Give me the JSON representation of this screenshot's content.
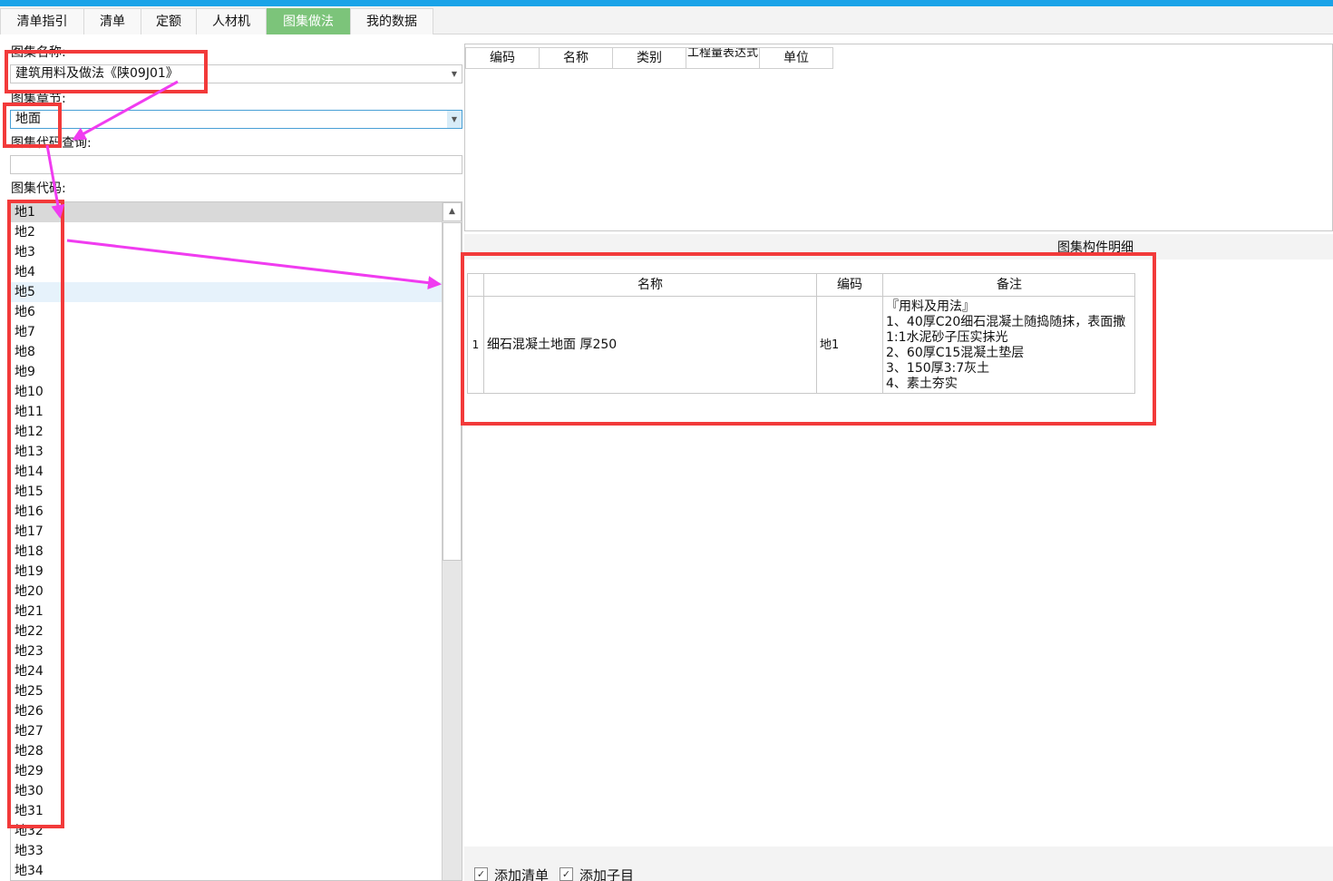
{
  "tabs": [
    {
      "label": "清单指引",
      "active": false
    },
    {
      "label": "清单",
      "active": false
    },
    {
      "label": "定额",
      "active": false
    },
    {
      "label": "人材机",
      "active": false
    },
    {
      "label": "图集做法",
      "active": true
    },
    {
      "label": "我的数据",
      "active": false
    }
  ],
  "atlas_name": {
    "label": "图集名称:",
    "value": "建筑用料及做法《陕09J01》"
  },
  "atlas_chapter": {
    "label": "图集章节:",
    "value": "地面"
  },
  "code_query": {
    "label": "图集代码查询:",
    "value": ""
  },
  "code_list": {
    "label": "图集代码:",
    "selected": "地1",
    "items": [
      "地1",
      "地2",
      "地3",
      "地4",
      "地5",
      "地6",
      "地7",
      "地8",
      "地9",
      "地10",
      "地11",
      "地12",
      "地13",
      "地14",
      "地15",
      "地16",
      "地17",
      "地18",
      "地19",
      "地20",
      "地21",
      "地22",
      "地23",
      "地24",
      "地25",
      "地26",
      "地27",
      "地28",
      "地29",
      "地30",
      "地31",
      "地32",
      "地33",
      "地34"
    ]
  },
  "upper_grid": {
    "columns": [
      "编码",
      "名称",
      "类别",
      "工程量表达式",
      "单位"
    ]
  },
  "detail": {
    "title": "图集构件明细",
    "columns": [
      "名称",
      "编码",
      "备注"
    ],
    "rows": [
      {
        "index": "1",
        "name": "细石混凝土地面 厚250",
        "code": "地1",
        "remark": [
          "『用料及用法』",
          "1、40厚C20细石混凝土随捣随抹，表面撒",
          "1:1水泥砂子压实抹光",
          "2、60厚C15混凝土垫层",
          "3、150厚3:7灰土",
          "4、素土夯实"
        ]
      }
    ]
  },
  "options": [
    {
      "label": "添加清单",
      "checked": true
    },
    {
      "label": "添加子目",
      "checked": true
    }
  ],
  "colors": {
    "accent": "#1aa3e8",
    "active_tab": "#7cc47a",
    "highlight": "#f23a3a",
    "arrow": "#f03cf0"
  }
}
